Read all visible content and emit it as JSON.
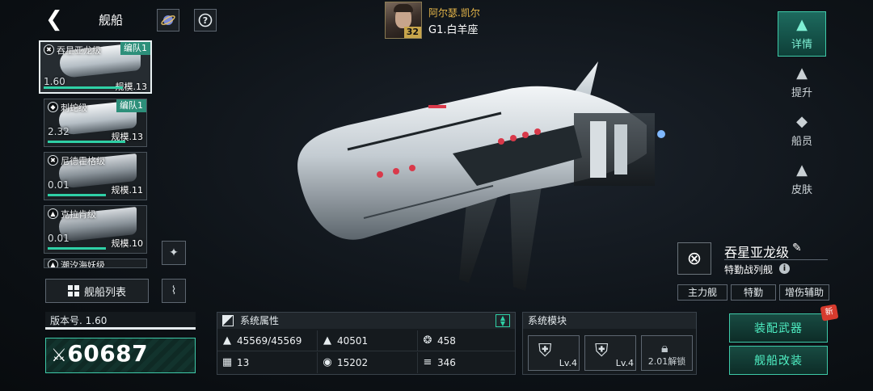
{
  "header": {
    "back_icon": "chevron-left-icon",
    "title": "舰船",
    "planet_icon": "planet-icon",
    "help_icon": "question-icon"
  },
  "commander": {
    "name": "阿尔瑟.凯尔",
    "sector": "G1.白羊座",
    "level": "32"
  },
  "nav": [
    {
      "label": "详情",
      "icon": "detail-icon",
      "active": true
    },
    {
      "label": "提升",
      "icon": "upgrade-icon",
      "active": false
    },
    {
      "label": "船员",
      "icon": "crew-icon",
      "active": false
    },
    {
      "label": "皮肤",
      "icon": "skin-icon",
      "active": false
    }
  ],
  "ship_list": [
    {
      "name": "吞星亚龙级",
      "fleet": "编队1",
      "version": "1.60",
      "scale": "规模.13",
      "progress": 0.75,
      "selected": true
    },
    {
      "name": "刺蛇级",
      "fleet": "编队1",
      "version": "2.32",
      "scale": "规模.13",
      "progress": 0.8,
      "selected": false
    },
    {
      "name": "尼德霍格级",
      "fleet": "",
      "version": "0.01",
      "scale": "规模.11",
      "progress": 0.6,
      "selected": false
    },
    {
      "name": "克拉肯级",
      "fleet": "",
      "version": "0.01",
      "scale": "规模.10",
      "progress": 0.6,
      "selected": false
    },
    {
      "name": "潮汐海妖级",
      "fleet": "",
      "version": "",
      "scale": "",
      "progress": 0,
      "selected": false
    }
  ],
  "ship_list_button": "舰船列表",
  "power": {
    "version_label": "版本号. 1.60",
    "value": "60687"
  },
  "attributes": {
    "title": "系统属性",
    "cells": [
      {
        "icon": "durability-icon",
        "value": "45569/45569"
      },
      {
        "icon": "armor-icon",
        "value": "40501"
      },
      {
        "icon": "speed-icon",
        "value": "458"
      },
      {
        "icon": "grid-icon",
        "value": "13"
      },
      {
        "icon": "shield-icon",
        "value": "15202"
      },
      {
        "icon": "cargo-icon",
        "value": "346"
      }
    ]
  },
  "modules": {
    "title": "系统模块",
    "slots": [
      {
        "type": "shield",
        "level": "Lv.4"
      },
      {
        "type": "shield-lock",
        "level": "Lv.4"
      },
      {
        "type": "locked",
        "unlock": "2.01解锁"
      }
    ]
  },
  "ship_info": {
    "name": "吞星亚龙级",
    "role": "特勤战列舰",
    "tags": [
      "主力舰",
      "特勤",
      "增伤辅助"
    ]
  },
  "actions": {
    "equip_weapon": "装配武器",
    "modify_ship": "舰船改装",
    "new_badge": "新"
  }
}
